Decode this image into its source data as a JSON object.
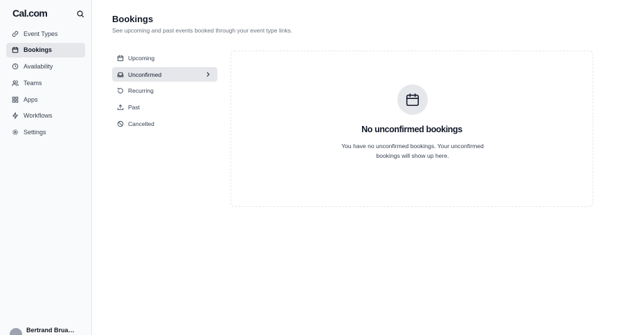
{
  "app": {
    "logo": "Cal.com"
  },
  "sidebar": {
    "items": [
      {
        "label": "Event Types",
        "icon": "link-icon"
      },
      {
        "label": "Bookings",
        "icon": "calendar-icon",
        "active": true
      },
      {
        "label": "Availability",
        "icon": "clock-icon"
      },
      {
        "label": "Teams",
        "icon": "users-icon"
      },
      {
        "label": "Apps",
        "icon": "grid-icon"
      },
      {
        "label": "Workflows",
        "icon": "zap-icon"
      },
      {
        "label": "Settings",
        "icon": "gear-icon"
      }
    ],
    "user": {
      "name": "Bertrand Bruan..."
    }
  },
  "header": {
    "title": "Bookings",
    "subtitle": "See upcoming and past events booked through your event type links."
  },
  "tabs": [
    {
      "label": "Upcoming",
      "icon": "calendar-icon"
    },
    {
      "label": "Unconfirmed",
      "icon": "inbox-icon",
      "active": true
    },
    {
      "label": "Recurring",
      "icon": "rotate-icon"
    },
    {
      "label": "Past",
      "icon": "upload-icon"
    },
    {
      "label": "Cancelled",
      "icon": "ban-icon"
    }
  ],
  "empty_state": {
    "icon": "calendar-icon",
    "title": "No unconfirmed bookings",
    "description": "You have no unconfirmed bookings. Your unconfirmed bookings will show up here."
  },
  "colors": {
    "active_bg": "#e5e7eb",
    "sidebar_bg": "#f9fafb",
    "text": "#111827",
    "muted": "#6b7280"
  }
}
